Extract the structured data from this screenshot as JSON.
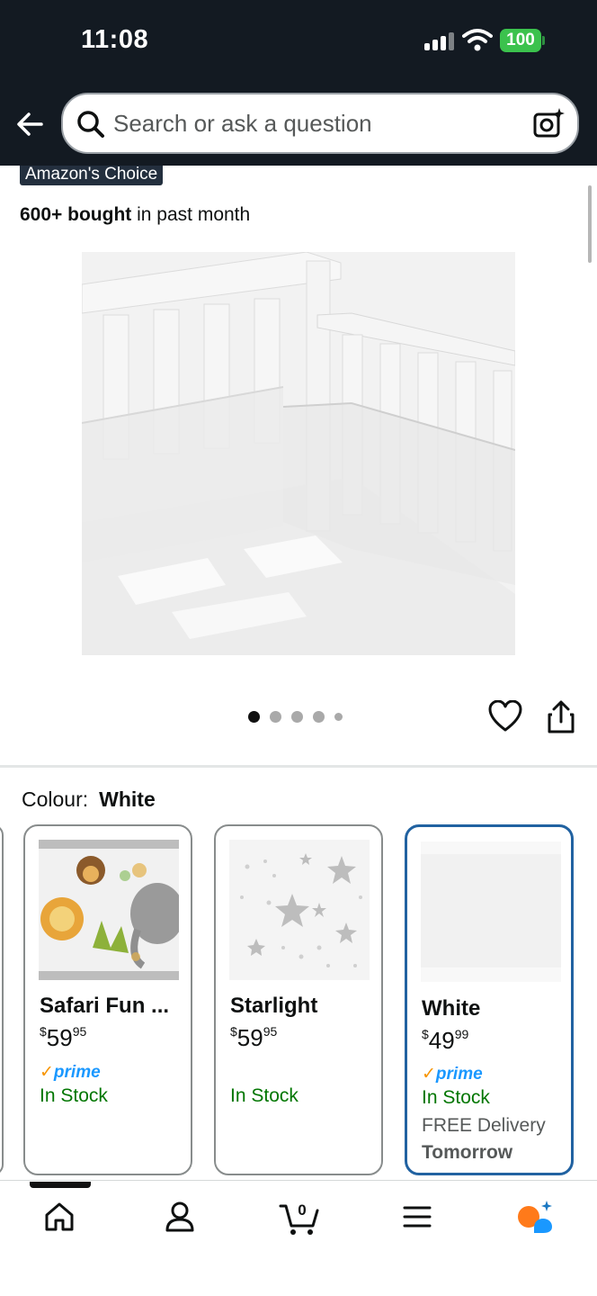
{
  "status_bar": {
    "time": "11:08",
    "battery": "100"
  },
  "header": {
    "search_placeholder": "Search or ask a question"
  },
  "product": {
    "badge": "Amazon's Choice",
    "bought_bold": "600+ bought",
    "bought_rest": " in past month",
    "carousel_count": 5,
    "carousel_active": 1
  },
  "variation": {
    "label": "Colour:",
    "selected": "White",
    "options": [
      {
        "name": "Safari Fun ...",
        "price_whole": "59",
        "price_frac": "95",
        "currency": "$",
        "prime": true,
        "stock": "In Stock"
      },
      {
        "name": "Starlight",
        "price_whole": "59",
        "price_frac": "95",
        "currency": "$",
        "prime": false,
        "stock": "In Stock"
      },
      {
        "name": "White",
        "price_whole": "49",
        "price_frac": "99",
        "currency": "$",
        "prime": true,
        "stock": "In Stock",
        "delivery": "FREE Delivery",
        "delivery_when": "Tomorrow"
      }
    ],
    "prime_label": "prime",
    "prime_check": "✓"
  },
  "bottom_nav": {
    "cart_count": "0"
  },
  "colors": {
    "header_bg": "#131a22",
    "accent_selected": "#2162a1",
    "stock_green": "#007600",
    "prime_blue": "#1a98ff",
    "prime_check": "#f79400"
  }
}
